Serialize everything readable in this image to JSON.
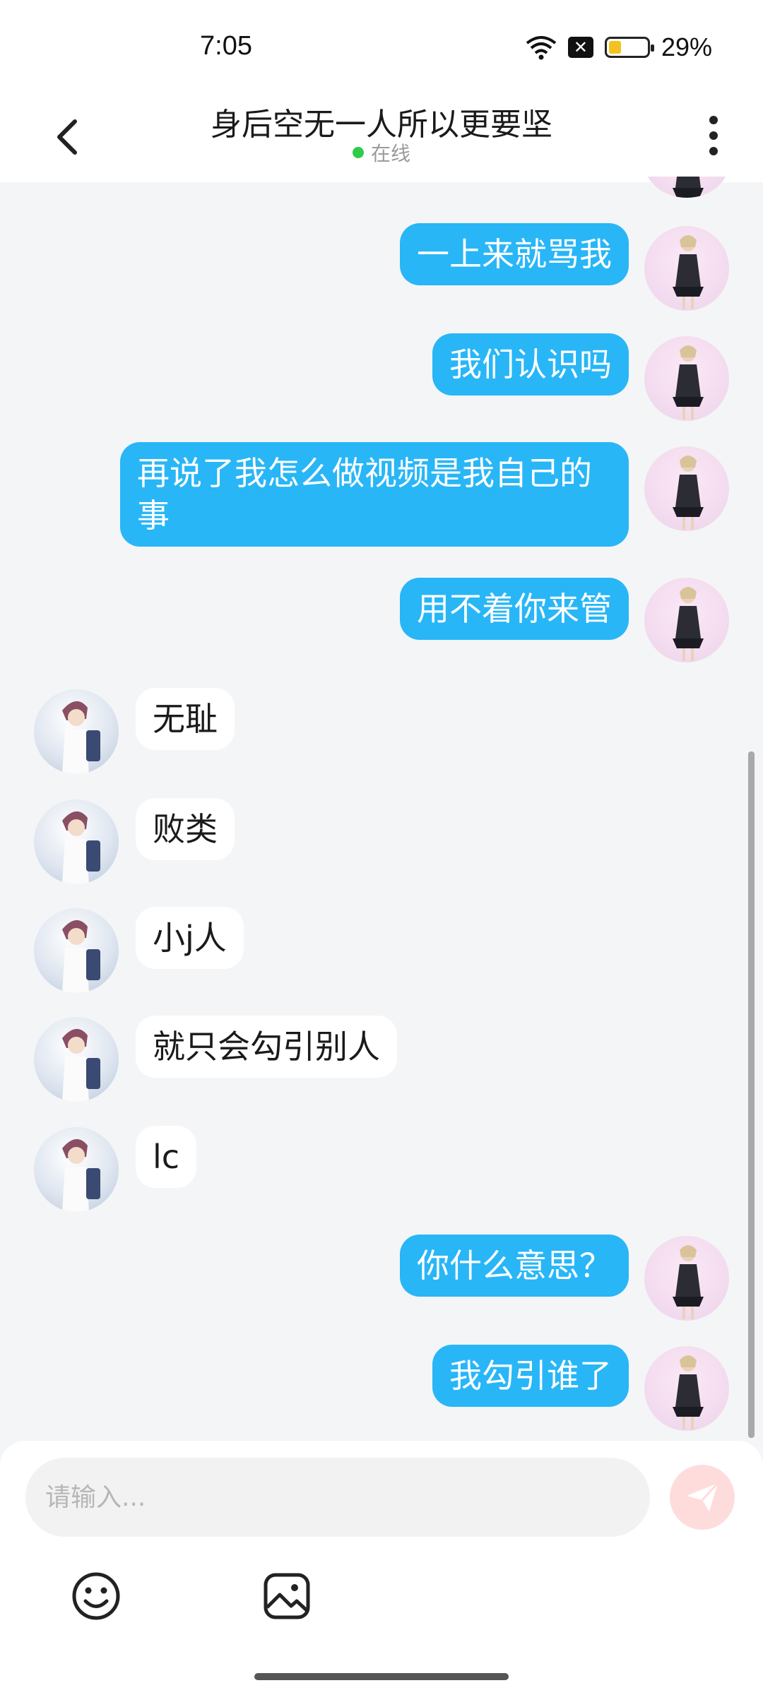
{
  "status_bar": {
    "time": "7:05",
    "battery": "29%",
    "battery_level": 0.29,
    "icons": [
      "wifi-icon",
      "notification-x-icon",
      "battery-icon"
    ]
  },
  "header": {
    "title": "身后空无一人所以更要坚",
    "status": "在线",
    "back_icon": "chevron-left-icon",
    "more_icon": "more-vertical-icon"
  },
  "messages": [
    {
      "from": "me",
      "text": "一上来就骂我"
    },
    {
      "from": "me",
      "text": "我们认识吗"
    },
    {
      "from": "me",
      "text": "再说了我怎么做视频是我自己的事"
    },
    {
      "from": "me",
      "text": "用不着你来管"
    },
    {
      "from": "other",
      "text": "无耻"
    },
    {
      "from": "other",
      "text": "败类"
    },
    {
      "from": "other",
      "text": "小j人"
    },
    {
      "from": "other",
      "text": "就只会勾引别人"
    },
    {
      "from": "other",
      "text": "lc"
    },
    {
      "from": "me",
      "text": "你什么意思？"
    },
    {
      "from": "me",
      "text": "我勾引谁了"
    }
  ],
  "composer": {
    "placeholder": "请输入...",
    "send_icon": "paper-plane-icon",
    "tools": [
      "smiley-icon",
      "image-icon"
    ]
  },
  "colors": {
    "my_bubble": "#28b6f7",
    "their_bubble": "#ffffff",
    "online": "#2ecc48",
    "send_button": "#ffdcdc"
  }
}
